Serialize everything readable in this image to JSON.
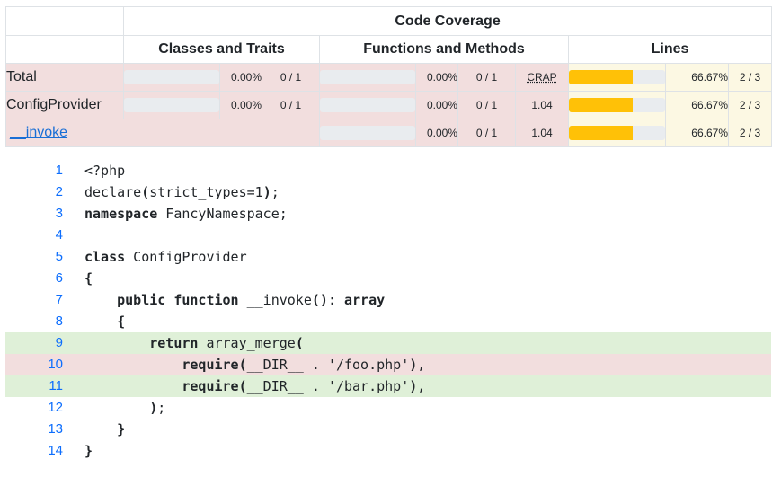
{
  "header": {
    "title": "Code Coverage",
    "groups": [
      "Classes and Traits",
      "Functions and Methods",
      "Lines"
    ]
  },
  "rows": [
    {
      "name": "Total",
      "is_link": false,
      "ct_pct": "0.00%",
      "ct_num": "0 / 1",
      "ct_bar": 0,
      "fm_pct": "0.00%",
      "fm_num": "0 / 1",
      "crap": "CRAP",
      "fm_bar": 0,
      "ln_pct": "66.67%",
      "ln_num": "2 / 3",
      "ln_bar": 66.67
    },
    {
      "name": "ConfigProvider",
      "is_link": false,
      "ct_pct": "0.00%",
      "ct_num": "0 / 1",
      "ct_bar": 0,
      "fm_pct": "0.00%",
      "fm_num": "0 / 1",
      "crap": "1.04",
      "fm_bar": 0,
      "ln_pct": "66.67%",
      "ln_num": "2 / 3",
      "ln_bar": 66.67
    },
    {
      "name": "__invoke",
      "is_link": true,
      "fm_pct": "0.00%",
      "fm_num": "0 / 1",
      "crap": "1.04",
      "fm_bar": 0,
      "ln_pct": "66.67%",
      "ln_num": "2 / 3",
      "ln_bar": 66.67
    }
  ],
  "colors": {
    "danger_bg": "#f2dede",
    "warning_bg": "#fcf8e3",
    "success_bg": "#dff0d8",
    "bar_fill": "#ffc107",
    "bar_track": "#e9ecef",
    "line_number": "#0d6efd"
  },
  "code": [
    {
      "n": "1",
      "text": "<?php",
      "cov": "none"
    },
    {
      "n": "2",
      "text": "declare(strict_types=1);",
      "cov": "none"
    },
    {
      "n": "3",
      "text": "namespace FancyNamespace;",
      "cov": "none"
    },
    {
      "n": "4",
      "text": "",
      "cov": "none"
    },
    {
      "n": "5",
      "text": "class ConfigProvider",
      "cov": "none"
    },
    {
      "n": "6",
      "text": "{",
      "cov": "none"
    },
    {
      "n": "7",
      "text": "    public function __invoke(): array",
      "cov": "none"
    },
    {
      "n": "8",
      "text": "    {",
      "cov": "none"
    },
    {
      "n": "9",
      "text": "        return array_merge(",
      "cov": "covered"
    },
    {
      "n": "10",
      "text": "            require(__DIR__ . '/foo.php'),",
      "cov": "uncovered"
    },
    {
      "n": "11",
      "text": "            require(__DIR__ . '/bar.php'),",
      "cov": "covered"
    },
    {
      "n": "12",
      "text": "        );",
      "cov": "none"
    },
    {
      "n": "13",
      "text": "    }",
      "cov": "none"
    },
    {
      "n": "14",
      "text": "}",
      "cov": "none"
    }
  ]
}
